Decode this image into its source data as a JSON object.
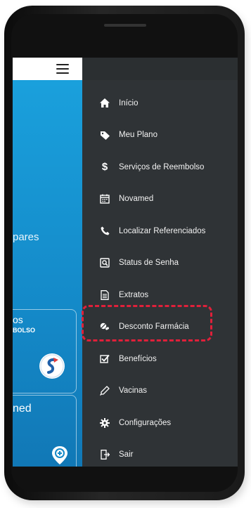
{
  "left_panel": {
    "comparar_fragment": "pares",
    "card1_title_fragment": "os",
    "card1_sub_fragment": "BOLSO",
    "card2_title_fragment": "ned"
  },
  "menu": {
    "items": [
      {
        "label": "Início",
        "icon": "home-icon"
      },
      {
        "label": "Meu Plano",
        "icon": "tag-icon"
      },
      {
        "label": "Serviços de Reembolso",
        "icon": "dollar-icon"
      },
      {
        "label": "Novamed",
        "icon": "calendar-icon"
      },
      {
        "label": "Localizar Referenciados",
        "icon": "phone-icon"
      },
      {
        "label": "Status de Senha",
        "icon": "search-document-icon"
      },
      {
        "label": "Extratos",
        "icon": "document-icon"
      },
      {
        "label": "Desconto Farmácia",
        "icon": "pills-icon"
      },
      {
        "label": "Benefícios",
        "icon": "checkbox-icon"
      },
      {
        "label": "Vacinas",
        "icon": "syringe-icon"
      },
      {
        "label": "Configurações",
        "icon": "gear-icon"
      },
      {
        "label": "Sair",
        "icon": "exit-icon"
      }
    ]
  },
  "colors": {
    "drawer_bg": "#2f3336",
    "app_blue": "#1489c8",
    "highlight": "#e0203a"
  }
}
